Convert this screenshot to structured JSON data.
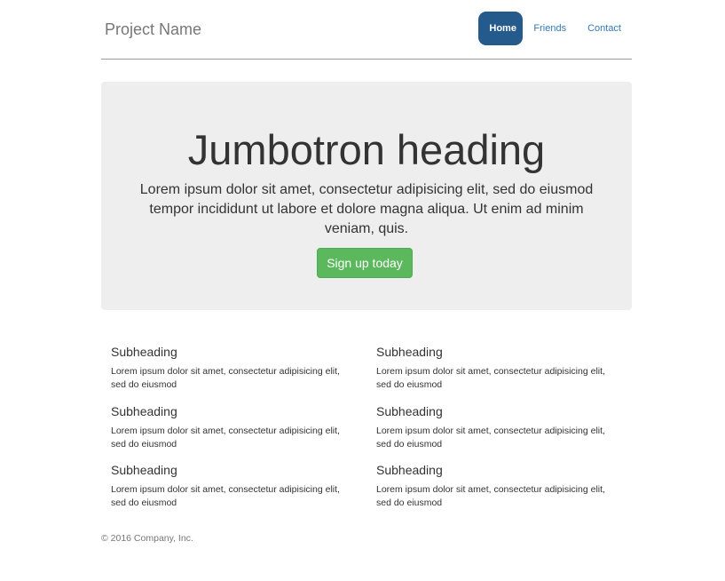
{
  "header": {
    "brand": "Project Name",
    "nav": [
      {
        "label": "Home",
        "active": true
      },
      {
        "label": "Friends",
        "active": false
      },
      {
        "label": "Contact",
        "active": false
      }
    ]
  },
  "jumbotron": {
    "heading": "Jumbotron heading",
    "lead": "Lorem ipsum dolor sit amet, consectetur adipisicing elit, sed do eiusmod tempor incididunt ut labore et dolore magna aliqua. Ut enim ad minim veniam, quis.",
    "button": "Sign up today"
  },
  "marketing": {
    "left": [
      {
        "heading": "Subheading",
        "text": "Lorem ipsum dolor sit amet, consectetur adipisicing elit, sed do eiusmod"
      },
      {
        "heading": "Subheading",
        "text": "Lorem ipsum dolor sit amet, consectetur adipisicing elit, sed do eiusmod"
      },
      {
        "heading": "Subheading",
        "text": "Lorem ipsum dolor sit amet, consectetur adipisicing elit, sed do eiusmod"
      }
    ],
    "right": [
      {
        "heading": "Subheading",
        "text": "Lorem ipsum dolor sit amet, consectetur adipisicing elit, sed do eiusmod"
      },
      {
        "heading": "Subheading",
        "text": "Lorem ipsum dolor sit amet, consectetur adipisicing elit, sed do eiusmod"
      },
      {
        "heading": "Subheading",
        "text": "Lorem ipsum dolor sit amet, consectetur adipisicing elit, sed do eiusmod"
      }
    ]
  },
  "footer": {
    "text": "© 2016 Company, Inc."
  },
  "colors": {
    "nav_active_bg": "#255a8c",
    "link": "#337ab7",
    "jumbotron_bg": "#eeeeee",
    "button_success": "#5cb85c"
  }
}
